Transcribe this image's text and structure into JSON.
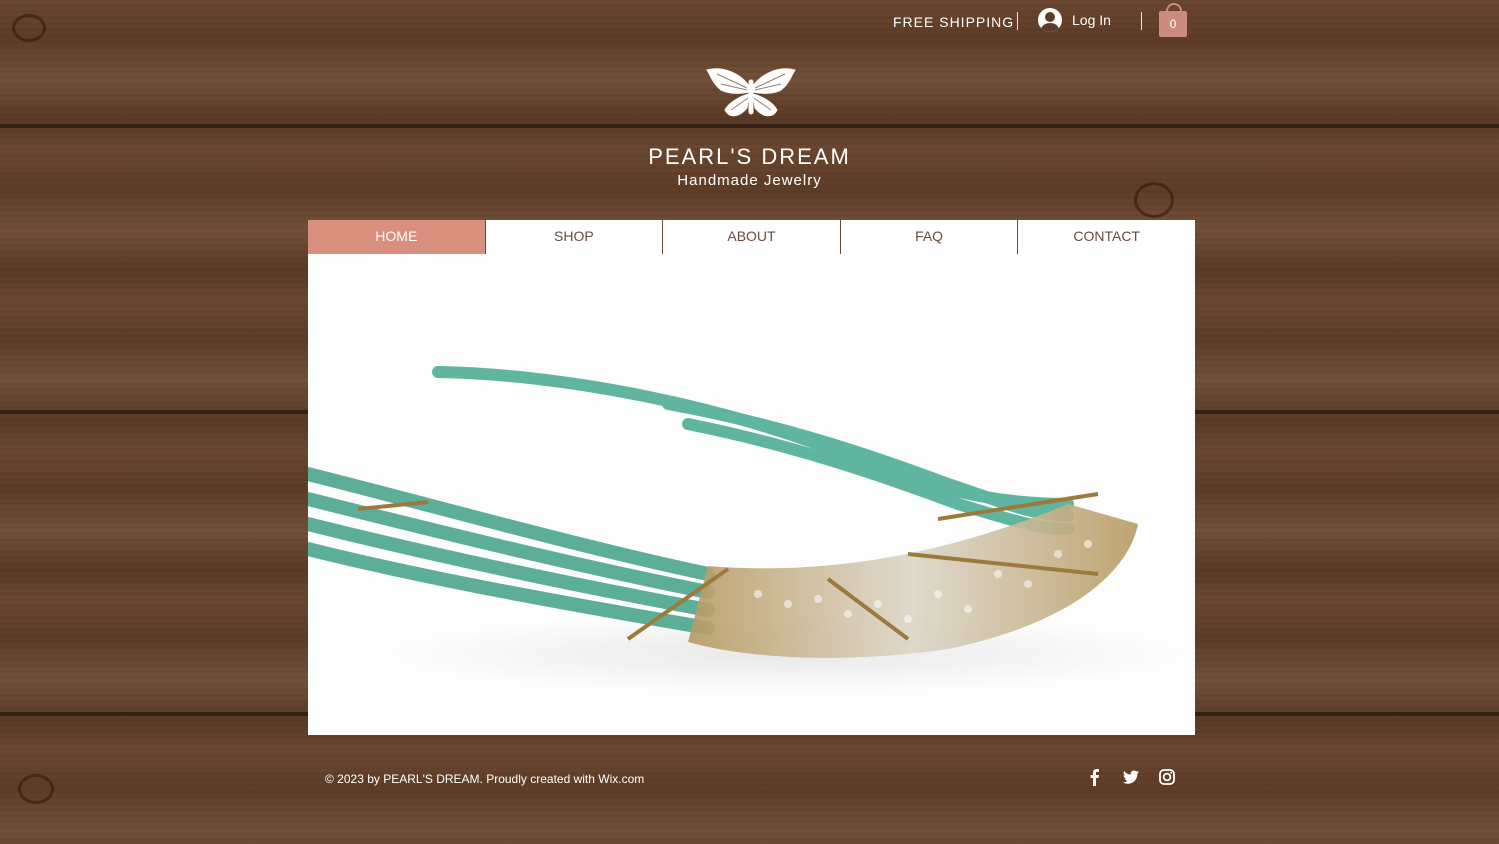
{
  "header": {
    "free_shipping": "FREE SHIPPING",
    "login_label": "Log In",
    "cart_count": "0",
    "icons": [
      "avatar-icon",
      "shopping-bag-icon"
    ]
  },
  "brand": {
    "title": "PEARL'S DREAM",
    "subtitle": "Handmade Jewelry",
    "logo_icon": "butterfly-icon"
  },
  "nav": {
    "items": [
      {
        "label": "HOME",
        "active": true
      },
      {
        "label": "SHOP",
        "active": false
      },
      {
        "label": "ABOUT",
        "active": false
      },
      {
        "label": "FAQ",
        "active": false
      },
      {
        "label": "CONTACT",
        "active": false
      }
    ],
    "active_color": "#d98f7e",
    "text_color": "#6b4a3a"
  },
  "hero": {
    "image_subject": "turquoise and gold beaded necklace"
  },
  "footer": {
    "copyright": "© 2023 by PEARL'S DREAM. Proudly created with Wix.com",
    "social_icons": [
      "facebook-icon",
      "twitter-icon",
      "instagram-icon"
    ]
  },
  "colors": {
    "accent": "#d98f7e",
    "cart": "#c98c7d",
    "wood": "#5e3d28"
  }
}
